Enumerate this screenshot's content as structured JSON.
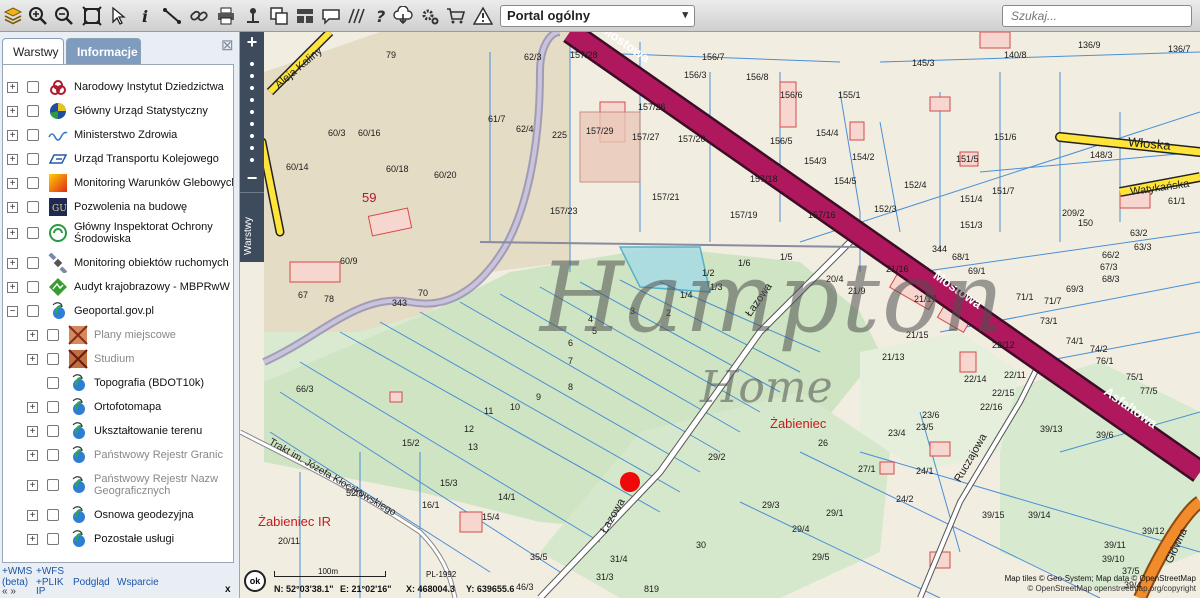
{
  "toolbar": {
    "icons": [
      "layers-icon",
      "zoom-in-icon",
      "zoom-out-icon",
      "zoom-extent-icon",
      "pointer-icon",
      "info-icon",
      "measure-icon",
      "link-icon",
      "print-icon",
      "pin-icon",
      "copy-icon",
      "layout-icon",
      "comment-icon",
      "hatch-icon",
      "help-icon",
      "download-icon",
      "settings-icon",
      "cart-icon",
      "warning-icon"
    ],
    "portal_select": "Portal ogólny",
    "search_placeholder": "Szukaj..."
  },
  "panel": {
    "tabs": [
      "Warstwy",
      "Informacje"
    ],
    "layers": [
      {
        "label": "Narodowy Instytut Dziedzictwa",
        "icon": "heritage-icon",
        "dim": false
      },
      {
        "label": "Główny Urząd Statystyczny",
        "icon": "statistics-icon",
        "dim": false
      },
      {
        "label": "Ministerstwo Zdrowia",
        "icon": "health-icon",
        "dim": false
      },
      {
        "label": "Urząd Transportu Kolejowego",
        "icon": "rail-icon",
        "dim": false
      },
      {
        "label": "Monitoring Warunków Glebowych",
        "icon": "soil-icon",
        "dim": false
      },
      {
        "label": "Pozwolenia na budowę",
        "icon": "building-permit-icon",
        "dim": false
      },
      {
        "label": "Główny Inspektorat Ochrony Środowiska",
        "icon": "environment-icon",
        "dim": false
      },
      {
        "label": "Monitoring obiektów ruchomych",
        "icon": "satellite-icon",
        "dim": false
      },
      {
        "label": "Audyt krajobrazowy - MBPRwW",
        "icon": "landscape-icon",
        "dim": false
      },
      {
        "label": "Geoportal.gov.pl",
        "icon": "geoportal-icon",
        "dim": false
      }
    ],
    "sublayers": [
      {
        "label": "Plany miejscowe",
        "icon": "plans-icon",
        "dim": true,
        "exp": true
      },
      {
        "label": "Studium",
        "icon": "study-icon",
        "dim": true,
        "exp": true
      },
      {
        "label": "Topografia (BDOT10k)",
        "icon": "geoportal-icon",
        "dim": false,
        "exp": false
      },
      {
        "label": "Ortofotomapa",
        "icon": "geoportal-icon",
        "dim": false,
        "exp": true
      },
      {
        "label": "Ukształtowanie terenu",
        "icon": "geoportal-icon",
        "dim": false,
        "exp": true
      },
      {
        "label": "Państwowy Rejestr Granic",
        "icon": "geoportal-icon",
        "dim": true,
        "exp": true
      },
      {
        "label": "Państwowy Rejestr Nazw Geograficznych",
        "icon": "geoportal-icon",
        "dim": true,
        "exp": true
      },
      {
        "label": "Osnowa geodezyjna",
        "icon": "geoportal-icon",
        "dim": false,
        "exp": true
      },
      {
        "label": "Pozostałe usługi",
        "icon": "geoportal-icon",
        "dim": false,
        "exp": true
      }
    ],
    "footer": {
      "wms": "+WMS",
      "wfs": "+WFS",
      "beta": "(beta)",
      "arrows": "« »",
      "plik": "+PLIK",
      "ip": "IP",
      "podglad": "Podgląd",
      "wsparcie": "Wsparcie",
      "close": "x"
    }
  },
  "map": {
    "side_tab": "Warstwy",
    "watermark": "Hampton",
    "watermark_sub": "Home",
    "roads": {
      "mostowa_1": "Mostowa",
      "mostowa_2": "Mostowa",
      "asfaltowa": "Asfaltowa",
      "wloska": "Włoska",
      "watykanska": "Watykańska",
      "lazowa_1": "Łazowa",
      "lazowa_2": "Łazowa",
      "ruczajowa": "Ruczajowa",
      "glowna": "Główna",
      "kaliny": "Aleja Kaliny",
      "trakt": "Trakt im. Józefa Kłoczkowskiego"
    },
    "places": [
      "Żabieniec",
      "Żabieniec IR"
    ],
    "plots": {
      "p79": "79",
      "p59": "59",
      "p62_3": "62/3",
      "p157_28": "157/28",
      "p156_3": "156/3",
      "p156_7": "156/7",
      "p145_3": "145/3",
      "p140_8": "140/8",
      "p136_9": "136/9",
      "p136_7": "136/7",
      "p156_8": "156/8",
      "p157_26": "157/26",
      "p156_6": "156/6",
      "p155_1": "155/1",
      "p61_7": "61/7",
      "p62_4": "62/4",
      "p225": "225",
      "p157_29": "157/29",
      "p157_27": "157/27",
      "p157_20": "157/20",
      "p156_5": "156/5",
      "p154_4": "154/4",
      "p154_3": "154/3",
      "p154_5": "154/5",
      "p154_2": "154/2",
      "p60_3": "60/3",
      "p60_16": "60/16",
      "p60_14": "60/14",
      "p60_18": "60/18",
      "p60_20": "60/20",
      "p157_21": "157/21",
      "p157_18": "157/18",
      "p152_4": "152/4",
      "p151_5": "151/5",
      "p151_6": "151/6",
      "p148_3": "148/3",
      "p157_23": "157/23",
      "p157_19": "157/19",
      "p157_16": "157/16",
      "p152_3": "152/3",
      "p151_4": "151/4",
      "p151_7": "151/7",
      "p209_2": "209/2",
      "p150": "150",
      "p151_3": "151/3",
      "p1_5": "1/5",
      "p1_6": "1/6",
      "p1_2": "1/2",
      "p1_3": "1/3",
      "p1_4": "1/4",
      "p20_4": "20/4",
      "p21_16": "21/16",
      "p21_9": "21/9",
      "p21_17": "21/17",
      "p344": "344",
      "p68_1": "68/1",
      "p69_1": "69/1",
      "p66_2": "66/2",
      "p67_3": "67/3",
      "p68_3": "68/3",
      "p63_2": "63/2",
      "p63_3": "63/3",
      "p61_1": "61/1",
      "p60_9": "60/9",
      "p67": "67",
      "p78": "78",
      "p70": "70",
      "p343": "343",
      "p4": "4",
      "p5": "5",
      "p6": "6",
      "p7": "7",
      "p8": "8",
      "p3": "3",
      "p2": "2",
      "p21_15": "21/15",
      "p21_13": "21/13",
      "p71_1": "71/1",
      "p73_1": "73/1",
      "p71_7": "71/7",
      "p69_3": "69/3",
      "p74_1": "74/1",
      "p74_2": "74/2",
      "p76_1": "76/1",
      "p22_12": "22/12",
      "p22_14": "22/14",
      "p22_11": "22/11",
      "p22_16": "22/16",
      "p22_15": "22/15",
      "p75_1": "75/1",
      "p77_5": "77/5",
      "p39_13": "39/13",
      "p39_6": "39/6",
      "p66_3": "66/3",
      "p9": "9",
      "p10": "10",
      "p11": "11",
      "p12": "12",
      "p13": "13",
      "p15_2": "15/2",
      "p15_3": "15/3",
      "p16_1": "16/1",
      "p14_1": "14/1",
      "p15_4": "15/4",
      "p23_6": "23/6",
      "p23_4": "23/4",
      "p23_5": "23/5",
      "p26": "26",
      "p29_2": "29/2",
      "p29_3": "29/3",
      "p29_1": "29/1",
      "p27_1": "27/1",
      "p24_1": "24/1",
      "p24_2": "24/2",
      "p29_4": "29/4",
      "p29_5": "29/5",
      "p30": "30",
      "p31_4": "31/4",
      "p31_3": "31/3",
      "p819": "819",
      "p46_3": "46/3",
      "p52_1": "52/1",
      "p20_11": "20/11",
      "p35_5": "35/5",
      "p39_15": "39/15",
      "p39_14": "39/14",
      "p39_11": "39/11",
      "p39_10": "39/10",
      "p39_12": "39/12",
      "p37_5": "37/5",
      "p39_4": "39/4"
    }
  },
  "status": {
    "ok": "ok",
    "scale": "100m",
    "crs": "PL-1992",
    "n": "N: 52°03'38.1\"",
    "e": "E: 21°02'16\"",
    "x": "X: 468004.3",
    "y": "Y: 639655.6",
    "attribution": "Map tiles © Geo-System; Map data © OpenStreetMap",
    "attribution2": "© OpenStreetMap openstreetmap.org/copyright"
  }
}
